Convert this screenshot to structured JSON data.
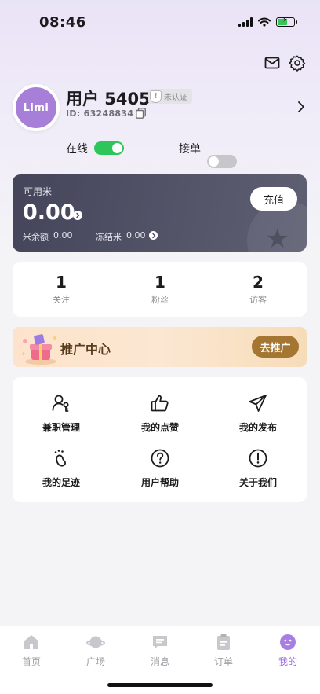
{
  "status_bar": {
    "time": "08:46"
  },
  "profile": {
    "avatar_text": "Limi",
    "username": "用户 5405",
    "verify_status": "未认证",
    "user_id": "ID: 63248834"
  },
  "toggles": [
    {
      "label": "在线",
      "state": "on"
    },
    {
      "label": "接单",
      "state": "off"
    }
  ],
  "wallet": {
    "label": "可用米",
    "amount": "0.00",
    "balance_label": "米余额",
    "balance_value": "0.00",
    "frozen_label": "冻结米",
    "frozen_value": "0.00",
    "recharge_label": "充值"
  },
  "stats": [
    {
      "value": "1",
      "label": "关注"
    },
    {
      "value": "1",
      "label": "粉丝"
    },
    {
      "value": "2",
      "label": "访客"
    }
  ],
  "promo": {
    "title": "推广中心",
    "button_label": "去推广"
  },
  "menu": [
    {
      "label": "兼职管理",
      "icon": "user-key-icon"
    },
    {
      "label": "我的点赞",
      "icon": "thumbs-up-icon"
    },
    {
      "label": "我的发布",
      "icon": "send-icon"
    },
    {
      "label": "我的足迹",
      "icon": "footprint-icon"
    },
    {
      "label": "用户帮助",
      "icon": "help-icon"
    },
    {
      "label": "关于我们",
      "icon": "info-icon"
    }
  ],
  "tabs": [
    {
      "label": "首页",
      "icon": "home-icon",
      "active": false
    },
    {
      "label": "广场",
      "icon": "planet-icon",
      "active": false
    },
    {
      "label": "消息",
      "icon": "message-icon",
      "active": false
    },
    {
      "label": "订单",
      "icon": "clipboard-icon",
      "active": false
    },
    {
      "label": "我的",
      "icon": "profile-face-icon",
      "active": true
    }
  ],
  "colors": {
    "accent": "#9b6fe0",
    "toggle_on": "#2dc65a",
    "wallet_bg": "#4a4b5f",
    "promo_button": "#a57532"
  }
}
